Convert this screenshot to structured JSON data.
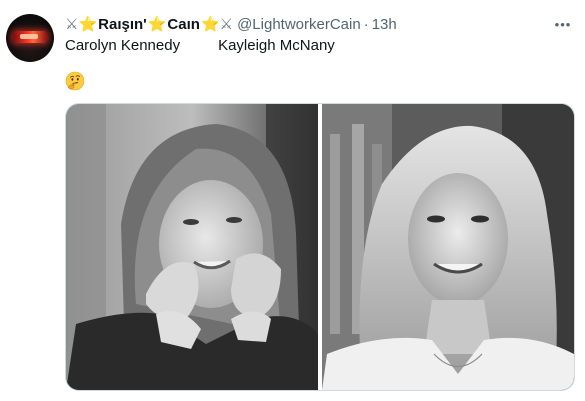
{
  "tweet": {
    "display_name": "Raışın' Caın",
    "display_name_parts": [
      "⚔",
      "⭐",
      "Raışın'",
      "⭐",
      "Caın",
      "⭐",
      "⚔"
    ],
    "handle": "@LightworkerCain",
    "separator": "·",
    "time": "13h",
    "more_label": "•••",
    "text": {
      "name_left": "Carolyn Kennedy",
      "name_right": "Kayleigh McNany"
    },
    "emoji": "thinking-face",
    "media": {
      "count": 2,
      "photos": [
        "carolyn-kennedy-photo",
        "kayleigh-mcnany-photo"
      ]
    }
  },
  "colors": {
    "text": "#0f1419",
    "secondary": "#536471",
    "border": "#cfd9de",
    "star": "#f5b51b"
  }
}
